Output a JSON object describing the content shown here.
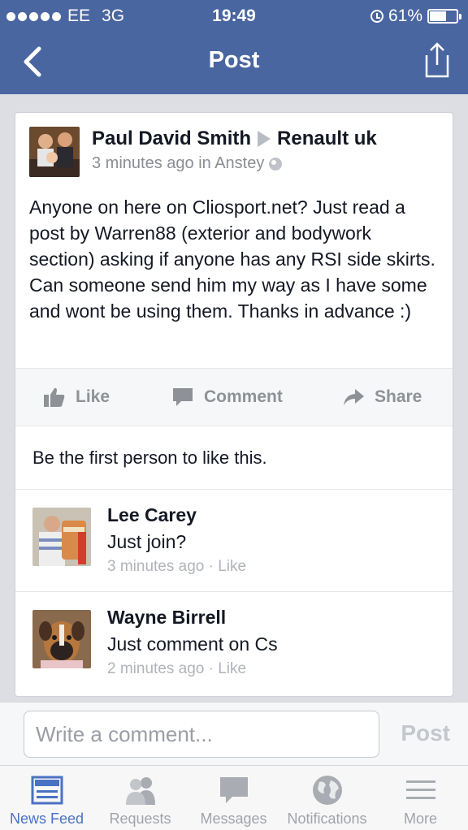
{
  "status_bar": {
    "carrier": "EE",
    "network": "3G",
    "time": "19:49",
    "battery": "61%",
    "battery_level": 0.61
  },
  "nav": {
    "title": "Post",
    "back_icon": "chevron-left-icon",
    "share_icon": "share-icon"
  },
  "post": {
    "author": "Paul David Smith",
    "target": "Renault uk",
    "meta": "3 minutes ago in Anstey",
    "text": "Anyone on here on Cliosport.net? Just read a post by Warren88 (exterior and bodywork section) asking if anyone has any RSI side skirts. Can someone send him my way as I have some and wont be using them. Thanks in advance :)"
  },
  "actions": {
    "like": "Like",
    "comment": "Comment",
    "share": "Share"
  },
  "likes_line": "Be the first person to like this.",
  "comments": [
    {
      "name": "Lee Carey",
      "text": "Just join?",
      "meta": "3 minutes ago · Like"
    },
    {
      "name": "Wayne Birrell",
      "text": "Just comment on Cs",
      "meta": "2 minutes ago · Like"
    }
  ],
  "composer": {
    "placeholder": "Write a comment...",
    "post_label": "Post"
  },
  "tabbar": [
    {
      "label": "News Feed",
      "icon": "news-feed-icon",
      "active": true
    },
    {
      "label": "Requests",
      "icon": "friends-icon",
      "active": false
    },
    {
      "label": "Messages",
      "icon": "messages-icon",
      "active": false
    },
    {
      "label": "Notifications",
      "icon": "globe-icon",
      "active": false
    },
    {
      "label": "More",
      "icon": "menu-icon",
      "active": false
    }
  ],
  "colors": {
    "brand": "#4a66a0",
    "active_tab": "#4a72c4",
    "muted": "#8e9196"
  }
}
